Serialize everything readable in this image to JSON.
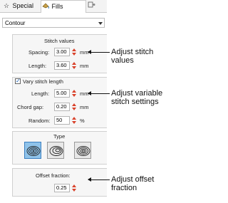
{
  "tabs": [
    {
      "label": "Special",
      "icon": "star-icon"
    },
    {
      "label": "Fills",
      "icon": "fill-icon"
    },
    {
      "label": "",
      "icon": "tab-icon"
    }
  ],
  "fill_type": {
    "selected": "Contour"
  },
  "stitch_values": {
    "heading": "Stitch values",
    "spacing_label": "Spacing:",
    "spacing_value": "3.00",
    "length_label": "Length:",
    "length_value": "3.60",
    "unit": "mm"
  },
  "variable_length": {
    "checkbox_label": "Vary stitch length",
    "checked": true,
    "length_label": "Length:",
    "length_value": "5.00",
    "chord_gap_label": "Chord gap:",
    "chord_gap_value": "0.20",
    "random_label": "Random:",
    "random_value": "50",
    "unit_mm": "mm",
    "unit_percent": "%"
  },
  "type": {
    "heading": "Type",
    "options": [
      "type-option-1",
      "type-option-2",
      "type-option-3"
    ],
    "selected_index": 0
  },
  "offset": {
    "label": "Offset fraction:",
    "value": "0.25"
  },
  "annotations": {
    "stitch_line1": "Adjust stitch",
    "stitch_line2": "values",
    "variable_line1": "Adjust variable",
    "variable_line2": "stitch settings",
    "offset_line1": "Adjust offset",
    "offset_line2": "fraction"
  }
}
